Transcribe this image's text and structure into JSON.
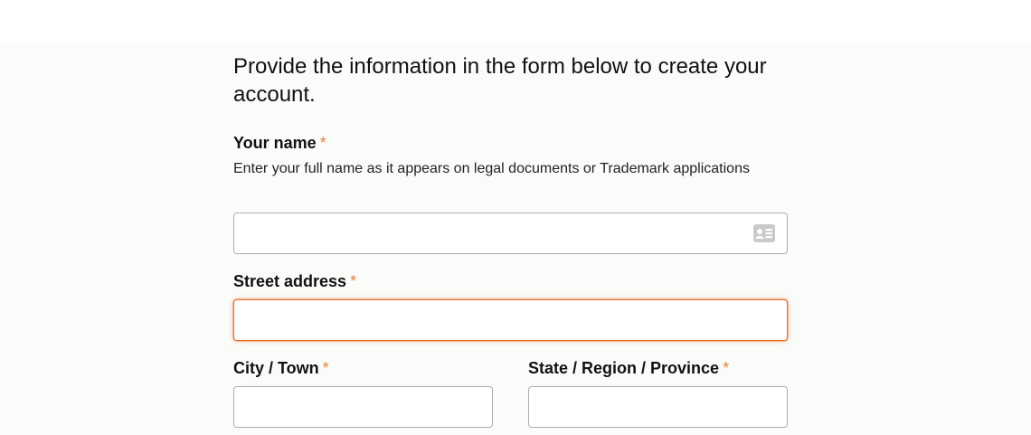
{
  "intro_text": "Provide the information in the form below to create your account.",
  "fields": {
    "name": {
      "label": "Your name",
      "required_mark": "*",
      "help": "Enter your full name as it appears on legal documents or Trademark applications",
      "value": "",
      "icon": "contact-card-icon"
    },
    "street": {
      "label": "Street address",
      "required_mark": "*",
      "value": "",
      "focused": true
    },
    "city": {
      "label": "City / Town",
      "required_mark": "*",
      "value": ""
    },
    "state": {
      "label": "State / Region / Province",
      "required_mark": "*",
      "value": ""
    }
  },
  "colors": {
    "required": "#e8833a",
    "focus_border": "#e8702a",
    "input_border": "#a9aeab",
    "page_background": "#fafcfa"
  }
}
